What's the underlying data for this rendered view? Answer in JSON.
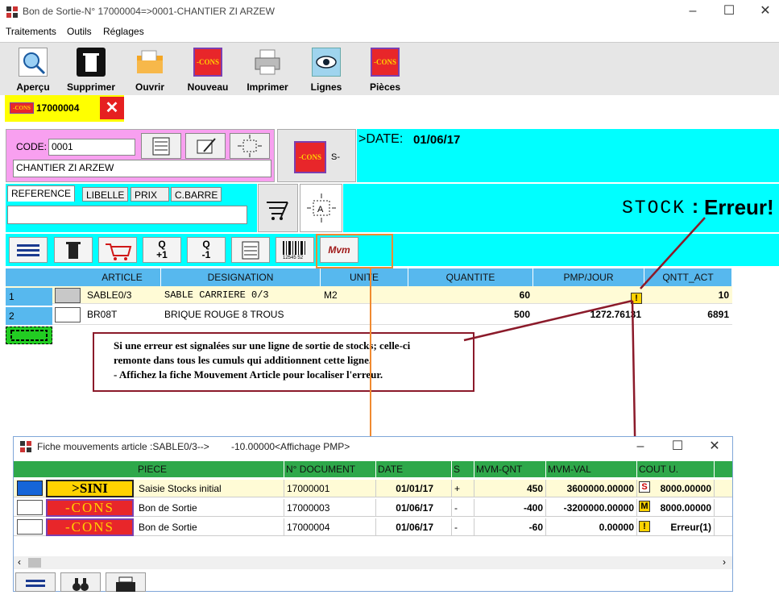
{
  "window": {
    "title": "Bon de Sortie-N° 17000004=>0001-CHANTIER ZI  ARZEW"
  },
  "menu": [
    "Traitements",
    "Outils",
    "Réglages"
  ],
  "toolbar": {
    "buttons": [
      "Aperçu",
      "Supprimer",
      "Ouvrir",
      "Nouveau",
      "Imprimer",
      "Lignes",
      "Pièces"
    ]
  },
  "doc_tab": {
    "number": "17000004",
    "logo": "-CONS"
  },
  "header": {
    "code_label": "CODE:",
    "code_value": "0001",
    "client_name": "CHANTIER ZI  ARZEW",
    "logo_suffix": "S-",
    "date_label": ">DATE:",
    "date_value": "01/06/17"
  },
  "search_tabs": [
    "REFERENCE",
    "LIBELLE",
    "PRIX",
    "C.BARRE"
  ],
  "search_value": "",
  "stock": {
    "label": "STOCK",
    "colon": ":",
    "value": "Erreur!"
  },
  "line_tools": [
    "Q\n+1",
    "Q\n-1",
    "Mvm",
    "12545 52"
  ],
  "grid": {
    "columns": [
      "ARTICLE",
      "DESIGNATION",
      "UNITE",
      "QUANTITE",
      "PMP/JOUR",
      "QNTT_ACT"
    ],
    "rows": [
      {
        "n": "1",
        "article": "SABLE0/3",
        "designation": "SABLE CARRIERE 0/3",
        "unite": "M2",
        "quantite": "60",
        "pmp": "",
        "qntt": "10"
      },
      {
        "n": "2",
        "article": "BR08T",
        "designation": "BRIQUE ROUGE 8 TROUS",
        "unite": "",
        "quantite": "500",
        "pmp": "1272.76131",
        "qntt": "6891"
      }
    ]
  },
  "note": {
    "lines": [
      "Si une erreur est signalées sur une ligne de sortie de stocks; celle-ci",
      "remonte dans tous les cumuls qui additionnent cette ligne.",
      "- Affichez la fiche Mouvement Article pour localiser l'erreur."
    ]
  },
  "child": {
    "title": "Fiche mouvements article :SABLE0/3-->",
    "title_extra": "-10.00000<Affichage PMP>",
    "columns": [
      "PIECE",
      "N° DOCUMENT",
      "DATE",
      "S",
      "MVM-QNT",
      "MVM-VAL",
      "COUT U."
    ],
    "rows": [
      {
        "logo": ">SINI",
        "piece": "Saisie Stocks initial",
        "doc": "17000001",
        "date": "01/01/17",
        "s": "+",
        "qnt": "450",
        "val": "3600000.00000",
        "flag": "S",
        "cout": "8000.00000"
      },
      {
        "logo": "-CONS",
        "piece": "Bon de Sortie",
        "doc": "17000003",
        "date": "01/06/17",
        "s": "-",
        "qnt": "-400",
        "val": "-3200000.00000",
        "flag": "M",
        "cout": "8000.00000"
      },
      {
        "logo": "-CONS",
        "piece": "Bon de Sortie",
        "doc": "17000004",
        "date": "01/06/17",
        "s": "-",
        "qnt": "-60",
        "val": "0.00000",
        "flag": "!",
        "cout": "Erreur(1)"
      }
    ]
  },
  "colors": {
    "cyan": "#00ffff",
    "pink": "#f8a0f0",
    "yellow": "#ffff00",
    "grid_header": "#57b8ee",
    "child_header": "#2ea84a",
    "annotation": "#8b1a2a",
    "connector": "#f08a30"
  }
}
